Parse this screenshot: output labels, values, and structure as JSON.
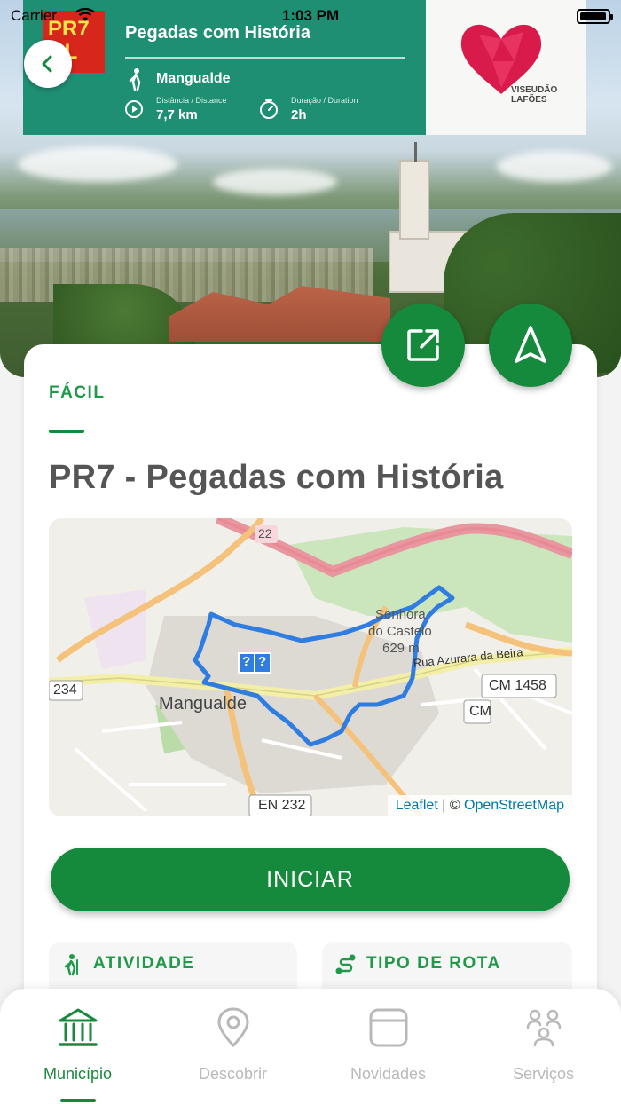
{
  "status_bar": {
    "carrier": "Carrier",
    "time": "1:03 PM"
  },
  "banner": {
    "badge_line1": "PR7",
    "badge_line2": "GL",
    "title": "Pegadas com História",
    "place": "Mangualde",
    "distance_label": "Distância / Distance",
    "distance_value": "7,7 km",
    "duration_label": "Duração / Duration",
    "duration_value": "2h",
    "logo_line1": "VISEUDÃO",
    "logo_line2": "LAFÕES"
  },
  "route": {
    "difficulty": "FÁCIL",
    "title": "PR7 - Pegadas com História"
  },
  "map": {
    "labels": {
      "road_22": "22",
      "road_234": "234",
      "town": "Mangualde",
      "senhora": "Senhora",
      "castelo": "do Castelo",
      "elev": "629 m",
      "street": "Rua Azurara da Beira",
      "cm1458": "CM 1458",
      "cm_partial": "CM",
      "en232": "EN 232",
      "marker": "?"
    },
    "attribution": {
      "leaflet": "Leaflet",
      "sep": " | © ",
      "osm": "OpenStreetMap"
    }
  },
  "actions": {
    "start": "INICIAR"
  },
  "info": {
    "activity": "ATIVIDADE",
    "route_type": "TIPO DE ROTA"
  },
  "tabs": [
    {
      "label": "Município",
      "active": true
    },
    {
      "label": "Descobrir",
      "active": false
    },
    {
      "label": "Novidades",
      "active": false
    },
    {
      "label": "Serviços",
      "active": false
    }
  ],
  "colors": {
    "primary": "#168a3c",
    "accent": "#1e9a48",
    "route_line": "#2f7de1",
    "inactive": "#b9b9b9"
  }
}
